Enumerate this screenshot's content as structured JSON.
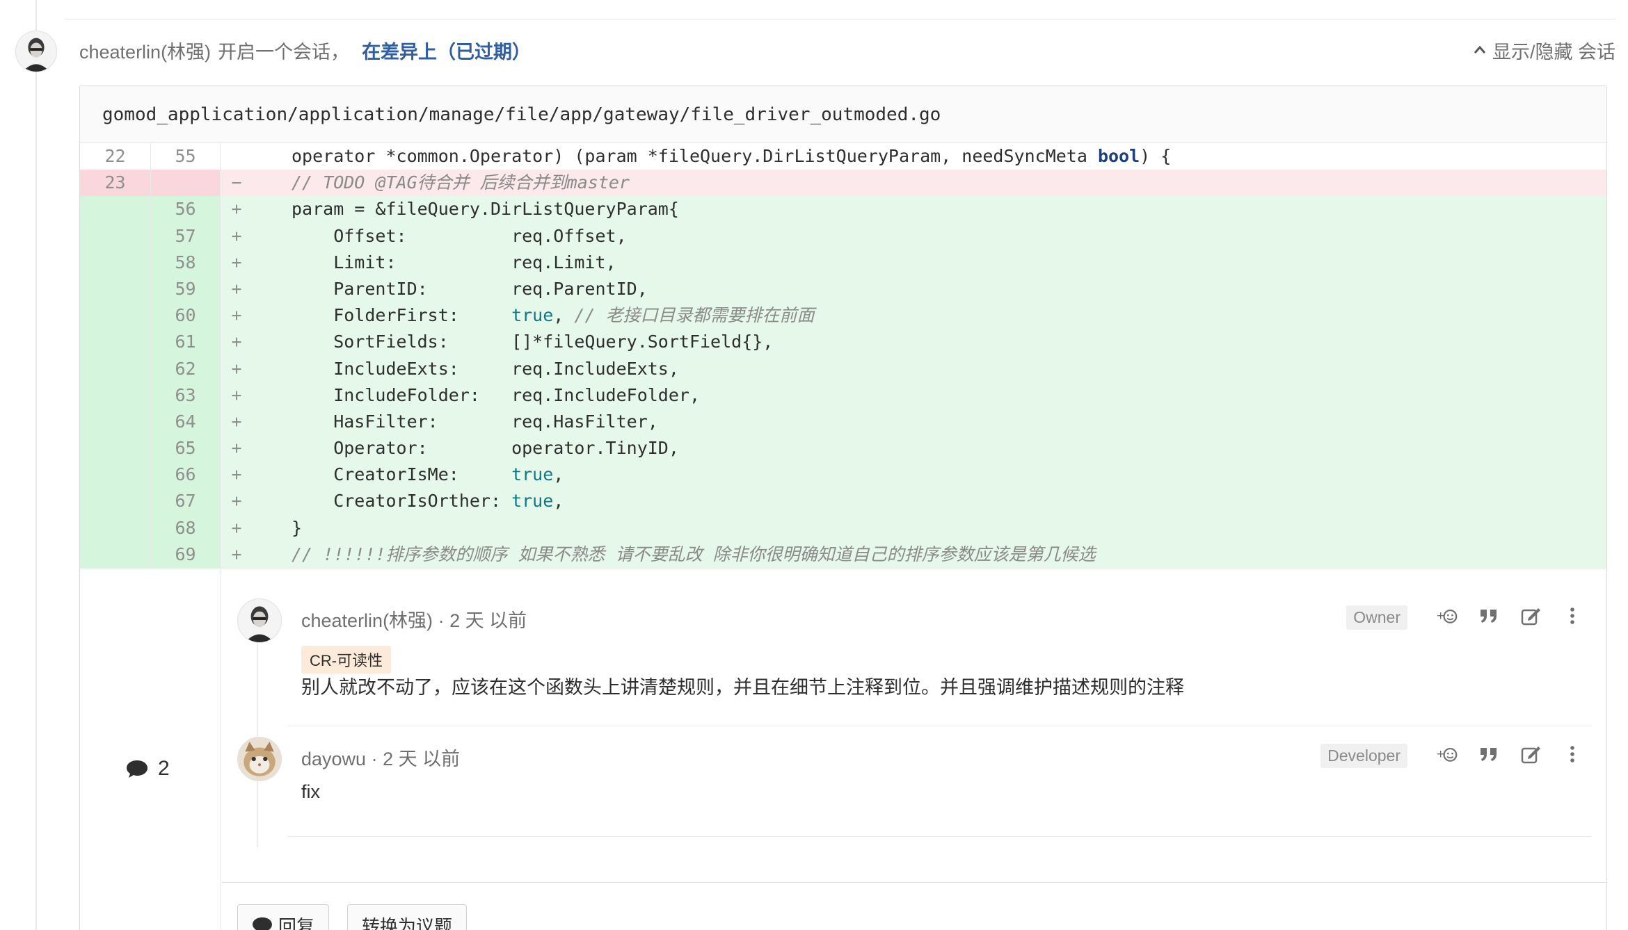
{
  "discussion": {
    "author": "cheaterlin(林强)",
    "verb": "开启一个会话，",
    "target_link": "在差异上（已过期）",
    "toggle_label": "显示/隐藏 会话"
  },
  "diff": {
    "file_path": "gomod_application/application/manage/file/app/gateway/file_driver_outmoded.go",
    "lines": [
      {
        "old": "22",
        "new": "55",
        "sign": "",
        "type": "ctx"
      },
      {
        "old": "23",
        "new": "",
        "sign": "−",
        "type": "del"
      },
      {
        "old": "",
        "new": "56",
        "sign": "+",
        "type": "add"
      },
      {
        "old": "",
        "new": "57",
        "sign": "+",
        "type": "add"
      },
      {
        "old": "",
        "new": "58",
        "sign": "+",
        "type": "add"
      },
      {
        "old": "",
        "new": "59",
        "sign": "+",
        "type": "add"
      },
      {
        "old": "",
        "new": "60",
        "sign": "+",
        "type": "add"
      },
      {
        "old": "",
        "new": "61",
        "sign": "+",
        "type": "add"
      },
      {
        "old": "",
        "new": "62",
        "sign": "+",
        "type": "add"
      },
      {
        "old": "",
        "new": "63",
        "sign": "+",
        "type": "add"
      },
      {
        "old": "",
        "new": "64",
        "sign": "+",
        "type": "add"
      },
      {
        "old": "",
        "new": "65",
        "sign": "+",
        "type": "add"
      },
      {
        "old": "",
        "new": "66",
        "sign": "+",
        "type": "add"
      },
      {
        "old": "",
        "new": "67",
        "sign": "+",
        "type": "add"
      },
      {
        "old": "",
        "new": "68",
        "sign": "+",
        "type": "add"
      },
      {
        "old": "",
        "new": "69",
        "sign": "+",
        "type": "add"
      }
    ],
    "code": {
      "l0a": "operator *common.Operator) (param *fileQuery.DirListQueryParam, needSyncMeta ",
      "l0kw": "bool",
      "l0b": ") {",
      "l1": "// TODO @TAG待合并 后续合并到master",
      "l2": "param = &fileQuery.DirListQueryParam{",
      "l3": "    Offset:          req.Offset,",
      "l4": "    Limit:           req.Limit,",
      "l5": "    ParentID:        req.ParentID,",
      "l6a": "    FolderFirst:     ",
      "l6lit": "true",
      "l6b": ", ",
      "l6cm": "// 老接口目录都需要排在前面",
      "l7": "    SortFields:      []*fileQuery.SortField{},",
      "l8": "    IncludeExts:     req.IncludeExts,",
      "l9": "    IncludeFolder:   req.IncludeFolder,",
      "l10": "    HasFilter:       req.HasFilter,",
      "l11": "    Operator:        operator.TinyID,",
      "l12a": "    CreatorIsMe:     ",
      "l12lit": "true",
      "l12b": ",",
      "l13a": "    CreatorIsOrther: ",
      "l13lit": "true",
      "l13b": ",",
      "l14": "}",
      "l15": "// !!!!!!排序参数的顺序 如果不熟悉 请不要乱改 除非你很明确知道自己的排序参数应该是第几候选"
    }
  },
  "thread": {
    "count": "2",
    "notes": [
      {
        "author": "cheaterlin(林强)",
        "time": "· 2 天 以前",
        "role": "Owner",
        "label": "CR-可读性",
        "body": "别人就改不动了，应该在这个函数头上讲清楚规则，并且在细节上注释到位。并且强调维护描述规则的注释"
      },
      {
        "author": "dayowu",
        "time": "· 2 天 以前",
        "role": "Developer",
        "label": "",
        "body": "fix"
      }
    ],
    "reply_label": "回复",
    "convert_label": "转换为议题"
  },
  "colors": {
    "link": "#2f5fa1",
    "added_bg": "#e6f8ea",
    "removed_bg": "#fbe9eb",
    "label_bg": "#fdebd9"
  },
  "icons": [
    "chevron-up-icon",
    "add-reaction-icon",
    "quote-icon",
    "edit-icon",
    "more-vertical-icon",
    "comment-icon"
  ]
}
